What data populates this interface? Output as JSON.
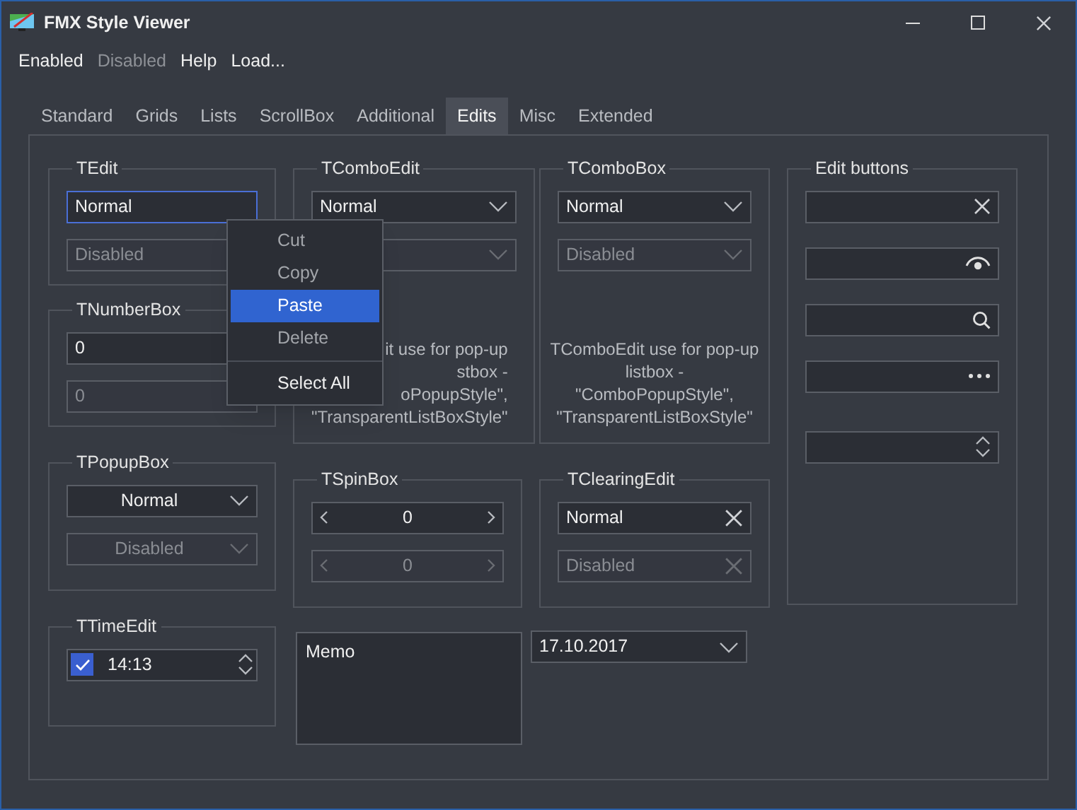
{
  "window": {
    "title": "FMX Style Viewer"
  },
  "menu": [
    {
      "label": "Enabled",
      "disabled": false
    },
    {
      "label": "Disabled",
      "disabled": true
    },
    {
      "label": "Help",
      "disabled": false
    },
    {
      "label": "Load...",
      "disabled": false
    }
  ],
  "tabs": [
    {
      "label": "Standard",
      "selected": false
    },
    {
      "label": "Grids",
      "selected": false
    },
    {
      "label": "Lists",
      "selected": false
    },
    {
      "label": "ScrollBox",
      "selected": false
    },
    {
      "label": "Additional",
      "selected": false
    },
    {
      "label": "Edits",
      "selected": true
    },
    {
      "label": "Misc",
      "selected": false
    },
    {
      "label": "Extended",
      "selected": false
    }
  ],
  "tedit": {
    "title": "TEdit",
    "fields": [
      {
        "value": "Normal",
        "disabled": false,
        "focused": true
      },
      {
        "value": "Disabled",
        "disabled": true,
        "focused": false
      }
    ]
  },
  "tnumberbox": {
    "title": "TNumberBox",
    "fields": [
      {
        "value": "0",
        "disabled": false,
        "focused": false
      },
      {
        "value": "0",
        "disabled": true,
        "focused": false
      }
    ]
  },
  "tpopupbox": {
    "title": "TPopupBox",
    "fields": [
      {
        "value": "Normal",
        "disabled": false
      },
      {
        "value": "Disabled",
        "disabled": true
      }
    ]
  },
  "ttimeedit": {
    "title": "TTimeEdit",
    "checked": true,
    "value": "14:13"
  },
  "tcomboedit": {
    "title": "TComboEdit",
    "fields": [
      {
        "value": "Normal",
        "disabled": false
      },
      {
        "disabled": true
      }
    ],
    "note_lines": [
      "it use for pop-up",
      "stbox -",
      "oPopupStyle\",",
      "\"TransparentListBoxStyle\""
    ]
  },
  "tspinbox": {
    "title": "TSpinBox",
    "fields": [
      {
        "value": "0",
        "disabled": false
      },
      {
        "value": "0",
        "disabled": true
      }
    ]
  },
  "memo": {
    "text": "Memo"
  },
  "tcombobox": {
    "title": "TComboBox",
    "fields": [
      {
        "value": "Normal",
        "disabled": false
      },
      {
        "value": "Disabled",
        "disabled": true
      }
    ],
    "note_lines": [
      "TComboEdit use for pop-up",
      "listbox -",
      "\"ComboPopupStyle\",",
      "\"TransparentListBoxStyle\""
    ]
  },
  "tclearingedit": {
    "title": "TClearingEdit",
    "fields": [
      {
        "value": "Normal",
        "disabled": false
      },
      {
        "value": "Disabled",
        "disabled": true
      }
    ]
  },
  "dateedit": {
    "value": "17.10.2017"
  },
  "editbuttons": {
    "title": "Edit buttons",
    "fields": [
      {
        "kind": "clear"
      },
      {
        "kind": "password"
      },
      {
        "kind": "search"
      },
      {
        "kind": "ellipsis"
      },
      {
        "kind": "spin"
      }
    ]
  },
  "context_menu": [
    {
      "kind": "item",
      "label": "Cut",
      "disabled": true,
      "selected": false
    },
    {
      "kind": "item",
      "label": "Copy",
      "disabled": true,
      "selected": false
    },
    {
      "kind": "item",
      "label": "Paste",
      "disabled": false,
      "selected": true
    },
    {
      "kind": "item",
      "label": "Delete",
      "disabled": true,
      "selected": false
    },
    {
      "kind": "separator"
    },
    {
      "kind": "item",
      "label": "Select All",
      "disabled": false,
      "selected": false
    }
  ]
}
